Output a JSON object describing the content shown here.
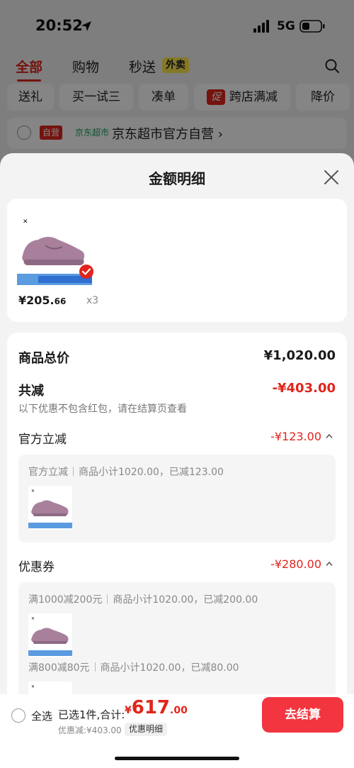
{
  "status_bar": {
    "time": "20:52",
    "network": "5G"
  },
  "top_tabs": {
    "items": [
      "全部",
      "购物",
      "秒送"
    ],
    "waimai_tag": "外卖"
  },
  "filters": {
    "items": [
      "送礼",
      "买一试三",
      "凑单",
      "跨店满减",
      "降价"
    ],
    "promo_badge": "促"
  },
  "shop": {
    "self_tag": "自营",
    "jd_tag": "京东超市",
    "name": "京东超市官方自营 ›"
  },
  "sheet": {
    "title": "金额明细"
  },
  "product": {
    "price_int": "¥205.",
    "price_dec": "66",
    "qty": "x3"
  },
  "details": {
    "total_label": "商品总价",
    "total_value": "¥1,020.00",
    "reduce_label": "共减",
    "reduce_value": "-¥403.00",
    "reduce_note": "以下优惠不包含红包，请在结算页查看",
    "official_label": "官方立减",
    "official_value": "-¥123.00",
    "official_line_a": "官方立减",
    "official_line_b": "商品小计1020.00，已减123.00",
    "coupon_label": "优惠券",
    "coupon_value": "-¥280.00",
    "coupon1_a": "满1000减200元",
    "coupon1_b": "商品小计1020.00，已减200.00",
    "coupon2_a": "满800减80元",
    "coupon2_b": "商品小计1020.00，已减80.00"
  },
  "bottom_bar": {
    "select_all": "全选",
    "selected": "已选1件,合计:",
    "currency": "¥",
    "total_int": "617",
    "total_dec": ".00",
    "saved": "优惠减:¥403.00",
    "detail_tag": "优惠明细",
    "checkout": "去结算"
  },
  "colors": {
    "accent": "#e1251b",
    "checkout_bg": "#f2353f",
    "shoe": "#a8809c"
  }
}
